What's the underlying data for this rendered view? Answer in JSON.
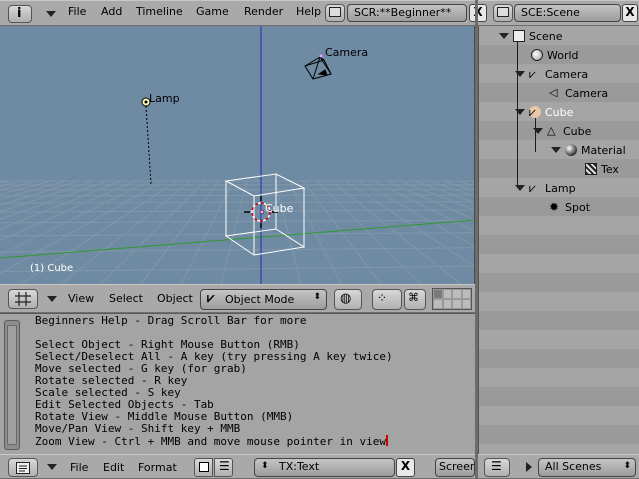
{
  "topbar": {
    "menus": [
      "File",
      "Add",
      "Timeline",
      "Game",
      "Render",
      "Help"
    ],
    "screen_field": "SCR:**Beginner**",
    "scene_field": "SCE:Scene",
    "close": "X"
  },
  "viewport": {
    "labels": {
      "camera": "Camera",
      "lamp": "Lamp",
      "cube": "Cube",
      "status": "(1) Cube"
    }
  },
  "viewport_header": {
    "menus": [
      "View",
      "Select",
      "Object"
    ],
    "mode": "Object Mode"
  },
  "text_editor": {
    "lines": [
      "Beginners Help - Drag Scroll Bar for more",
      "",
      "Select Object - Right Mouse Button (RMB)",
      "Select/Deselect All - A key (try pressing A key twice)",
      "Move selected - G key (for grab)",
      "Rotate selected - R key",
      "Scale selected - S key",
      "Edit Selected Objects - Tab",
      "Rotate View - Middle Mouse Button (MMB)",
      "Move/Pan View - Shift key + MMB",
      "Zoom View - Ctrl + MMB and move mouse pointer in view"
    ]
  },
  "text_header": {
    "menus": [
      "File",
      "Edit",
      "Format"
    ],
    "text_field": "TX:Text",
    "close": "X",
    "screen_btn": "Screen"
  },
  "outliner": {
    "items": [
      {
        "label": "Scene",
        "icon": "scene-icon"
      },
      {
        "label": "World",
        "icon": "world-icon"
      },
      {
        "label": "Camera",
        "icon": "object-icon"
      },
      {
        "label": "Camera",
        "icon": "camera-data-icon"
      },
      {
        "label": "Cube",
        "icon": "object-icon",
        "selected": true
      },
      {
        "label": "Cube",
        "icon": "mesh-icon"
      },
      {
        "label": "Material",
        "icon": "material-icon"
      },
      {
        "label": "Tex",
        "icon": "texture-icon"
      },
      {
        "label": "Lamp",
        "icon": "object-icon"
      },
      {
        "label": "Spot",
        "icon": "lamp-icon"
      }
    ],
    "footer_select": "All Scenes"
  },
  "colors": {
    "viewport_bg": "#6f8aa3",
    "grid": "#8296a8",
    "selected": "#ffffff",
    "cursor": "#d40000"
  }
}
